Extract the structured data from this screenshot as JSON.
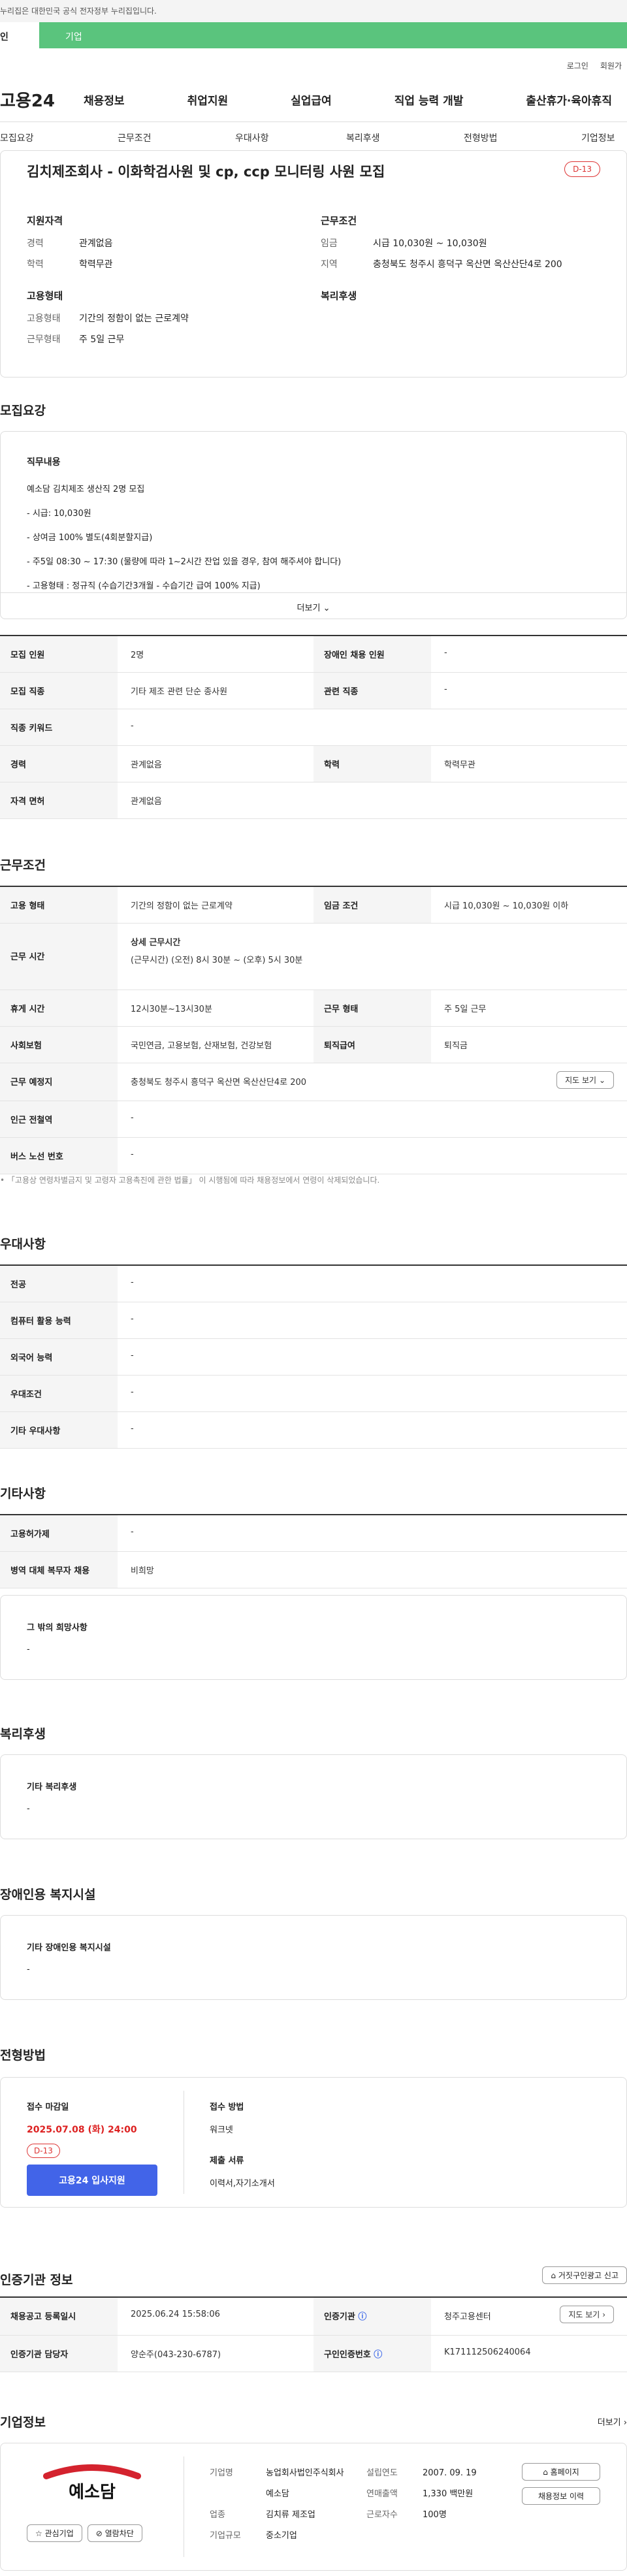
{
  "gov_bar": "누리집은 대한민국 공식 전자정부 누리집입니다.",
  "tabs": [
    "인",
    "기업"
  ],
  "util": [
    "로그인",
    "회원가"
  ],
  "gnb": {
    "logo": "고용24",
    "items": [
      "채용정보",
      "취업지원",
      "실업급여",
      "직업 능력 개발",
      "출산휴가·육아휴직"
    ]
  },
  "anchors": [
    "모집요강",
    "근무조건",
    "우대사항",
    "복리후생",
    "전형방법",
    "기업정보"
  ],
  "job": {
    "title": "김치제조회사 - 이화학검사원 및 cp, ccp 모니터링 사원 모집",
    "dday": "D-13",
    "qual_h": "지원자격",
    "cond_h": "근무조건",
    "emp_h": "고용형태",
    "welfare_h": "복리후생",
    "qual": [
      {
        "k": "경력",
        "v": "관계없음"
      },
      {
        "k": "학력",
        "v": "학력무관"
      }
    ],
    "cond": [
      {
        "k": "임금",
        "v": "시급 10,030원 ~ 10,030원"
      },
      {
        "k": "지역",
        "v": "충청북도 청주시 흥덕구 옥산면 옥산산단4로 200"
      }
    ],
    "emp": [
      {
        "k": "고용형태",
        "v": "기간의 정함이 없는 근로계약"
      },
      {
        "k": "근무형태",
        "v": "주 5일 근무"
      }
    ]
  },
  "recruit": {
    "heading": "모집요강",
    "duty_h": "직무내용",
    "duty_lines": [
      "예소담 김치제조 생산직 2명 모집",
      "- 시급: 10,030원",
      "- 상여금 100% 별도(4회분할지급)",
      "- 주5일 08:30 ~ 17:30 (물량에 따라 1~2시간 잔업 있을 경우, 참여 해주셔야 합니다)",
      "- 고용형태 : 정규직 (수습기간3개월 - 수습기간 급여 100% 지급)"
    ],
    "more": "더보기",
    "rows": [
      [
        {
          "th": "모집 인원",
          "td": "2명"
        },
        {
          "th": "장애인 채용 인원",
          "td": "-"
        }
      ],
      [
        {
          "th": "모집 직종",
          "td": "기타 제조 관련 단순 종사원"
        },
        {
          "th": "관련 직종",
          "td": "-"
        }
      ],
      [
        {
          "th": "직종 키워드",
          "td": "-"
        }
      ],
      [
        {
          "th": "경력",
          "td": "관계없음"
        },
        {
          "th": "학력",
          "td": "학력무관"
        }
      ],
      [
        {
          "th": "자격 면허",
          "td": "관계없음"
        }
      ]
    ]
  },
  "work": {
    "heading": "근무조건",
    "r1": [
      {
        "th": "고용 형태",
        "td": "기간의 정함이 없는 근로계약"
      },
      {
        "th": "임금 조건",
        "td": "시급 10,030원 ~ 10,030원 이하"
      }
    ],
    "hours_th": "근무 시간",
    "hours_h": "상세 근무시간",
    "hours_v": "(근무시간) (오전) 8시 30분 ~ (오후) 5시 30분",
    "r3": [
      {
        "th": "휴게 시간",
        "td": "12시30분~13시30분"
      },
      {
        "th": "근무 형태",
        "td": "주 5일 근무"
      }
    ],
    "r4": [
      {
        "th": "사회보험",
        "td": "국민연금, 고용보험, 산재보험, 건강보험"
      },
      {
        "th": "퇴직급여",
        "td": "퇴직금"
      }
    ],
    "place_th": "근무 예정지",
    "place_td": "충청북도 청주시 흥덕구 옥산면 옥산산단4로 200",
    "map_btn": "지도 보기",
    "r6": {
      "th": "인근 전철역",
      "td": "-"
    },
    "r7": {
      "th": "버스 노선 번호",
      "td": "-"
    },
    "note": "「고용상 연령차별금지 및 고령자 고용촉진에 관한 법률」 이 시행됨에 따라 채용정보에서 연령이 삭제되었습니다."
  },
  "pref": {
    "heading": "우대사항",
    "rows": [
      {
        "th": "전공",
        "td": "-"
      },
      {
        "th": "컴퓨터 활용 능력",
        "td": "-"
      },
      {
        "th": "외국어 능력",
        "td": "-"
      },
      {
        "th": "우대조건",
        "td": "-"
      },
      {
        "th": "기타 우대사항",
        "td": "-"
      }
    ]
  },
  "etc": {
    "heading": "기타사항",
    "rows": [
      {
        "th": "고용허가제",
        "td": "-"
      },
      {
        "th": "병역 대체 복무자 채용",
        "td": "비희망"
      }
    ],
    "box_h": "그 밖의 희망사항",
    "box_v": "-"
  },
  "welfare": {
    "heading": "복리후생",
    "box_h": "기타 복리후생",
    "box_v": "-"
  },
  "disabled": {
    "heading": "장애인용 복지시설",
    "box_h": "기타 장애인용 복지시설",
    "box_v": "-"
  },
  "process": {
    "heading": "전형방법",
    "deadline_h": "접수 마감일",
    "deadline": "2025.07.08 (화) 24:00",
    "dday": "D-13",
    "apply": "고용24 입사지원",
    "method_h": "접수 방법",
    "method": "워크넷",
    "docs_h": "제출 서류",
    "docs": "이력서,자기소개서"
  },
  "cert": {
    "heading": "인증기관 정보",
    "report": "거짓구인광고 신고",
    "r1": [
      {
        "th": "채용공고 등록일시",
        "td": "2025.06.24 15:58:06"
      },
      {
        "th": "인증기관",
        "td": "청주고용센터"
      }
    ],
    "r2": [
      {
        "th": "인증기관 담당자",
        "td": "양순주(043-230-6787)"
      },
      {
        "th": "구인인증번호",
        "td": "K171112506240064"
      }
    ],
    "map_btn": "지도 보기"
  },
  "company": {
    "heading": "기업정보",
    "more": "더보기",
    "logo_text": "예소담",
    "fav": "관심기업",
    "block": "열람차단",
    "left": [
      {
        "k": "기업명",
        "v": "농업회사법인주식회사예소담"
      },
      {
        "k": "업종",
        "v": "김치류 제조업"
      },
      {
        "k": "기업규모",
        "v": "중소기업"
      }
    ],
    "right": [
      {
        "k": "설립연도",
        "v": "2007. 09. 19"
      },
      {
        "k": "연매출액",
        "v": "1,330 백만원"
      },
      {
        "k": "근로자수",
        "v": "100명"
      }
    ],
    "homepage": "홈페이지",
    "history": "채용정보 이력"
  }
}
